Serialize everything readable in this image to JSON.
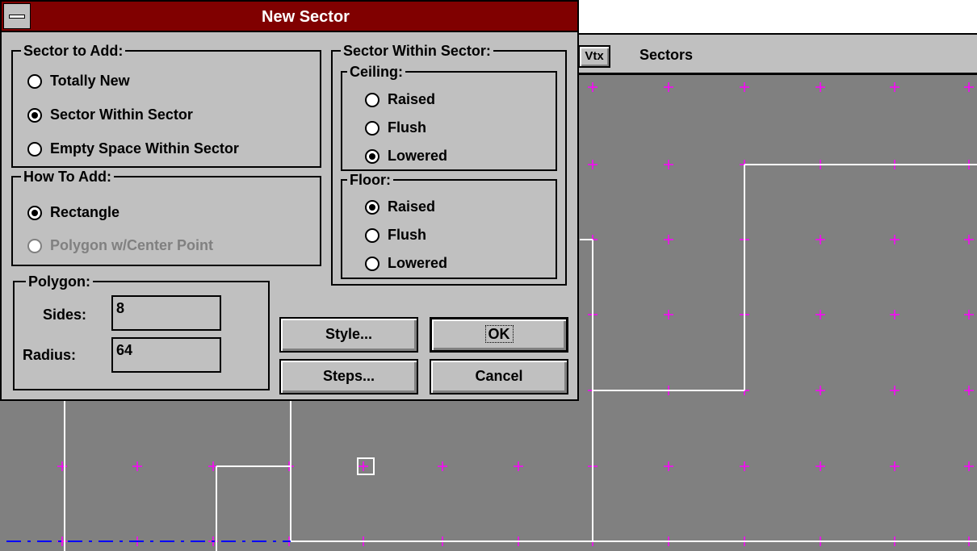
{
  "dialog": {
    "title": "New Sector",
    "sector_to_add": {
      "label": "Sector to Add:",
      "options": [
        {
          "label": "Totally New",
          "checked": false
        },
        {
          "label": "Sector Within Sector",
          "checked": true
        },
        {
          "label": "Empty Space Within Sector",
          "checked": false
        }
      ]
    },
    "how_to_add": {
      "label": "How To Add:",
      "options": [
        {
          "label": "Rectangle",
          "checked": true
        },
        {
          "label": "Polygon w/Center Point",
          "checked": false,
          "disabled": true
        }
      ]
    },
    "polygon": {
      "label": "Polygon:",
      "sides_label": "Sides:",
      "sides_value": "8",
      "radius_label": "Radius:",
      "radius_value": "64"
    },
    "sector_within_sector": {
      "label": "Sector Within Sector:",
      "ceiling": {
        "label": "Ceiling:",
        "options": [
          {
            "label": "Raised",
            "checked": false
          },
          {
            "label": "Flush",
            "checked": false
          },
          {
            "label": "Lowered",
            "checked": true
          }
        ]
      },
      "floor": {
        "label": "Floor:",
        "options": [
          {
            "label": "Raised",
            "checked": true
          },
          {
            "label": "Flush",
            "checked": false
          },
          {
            "label": "Lowered",
            "checked": false
          }
        ]
      }
    },
    "buttons": {
      "style": "Style...",
      "ok": "OK",
      "steps": "Steps...",
      "cancel": "Cancel"
    }
  },
  "toolbar": {
    "vtx_button": "Vtx",
    "mode_label": "Sectors"
  },
  "colors": {
    "titlebar": "#800000",
    "dialog_face": "#c0c0c0",
    "map_background": "#808080",
    "grid_marks": "#ff00ff",
    "map_lines": "#ffffff",
    "selected_line": "#0000ff"
  }
}
